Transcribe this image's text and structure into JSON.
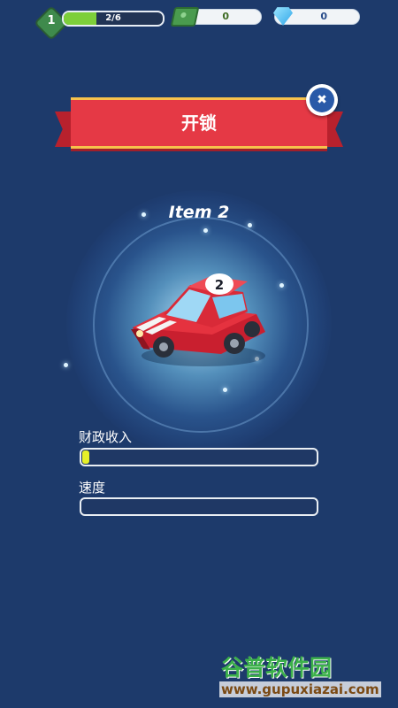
{
  "hud": {
    "level": "1",
    "xp_text": "2/6",
    "xp_progress": 0.333,
    "cash": "0",
    "gems": "0"
  },
  "banner": {
    "title": "开锁",
    "close_icon": "close-icon"
  },
  "item": {
    "name": "Item 2",
    "car_number": "2"
  },
  "stats": [
    {
      "label": "财政收入",
      "progress": 0.03
    },
    {
      "label": "速度",
      "progress": 0.0
    }
  ],
  "watermark": {
    "logo_text": "谷普软件园",
    "url": "www.gupuxiazai.com"
  },
  "colors": {
    "background": "#1d3a6b",
    "ribbon": "#e53945",
    "xp_fill": "#7dcf3a",
    "stat_fill": "#e6f028"
  }
}
